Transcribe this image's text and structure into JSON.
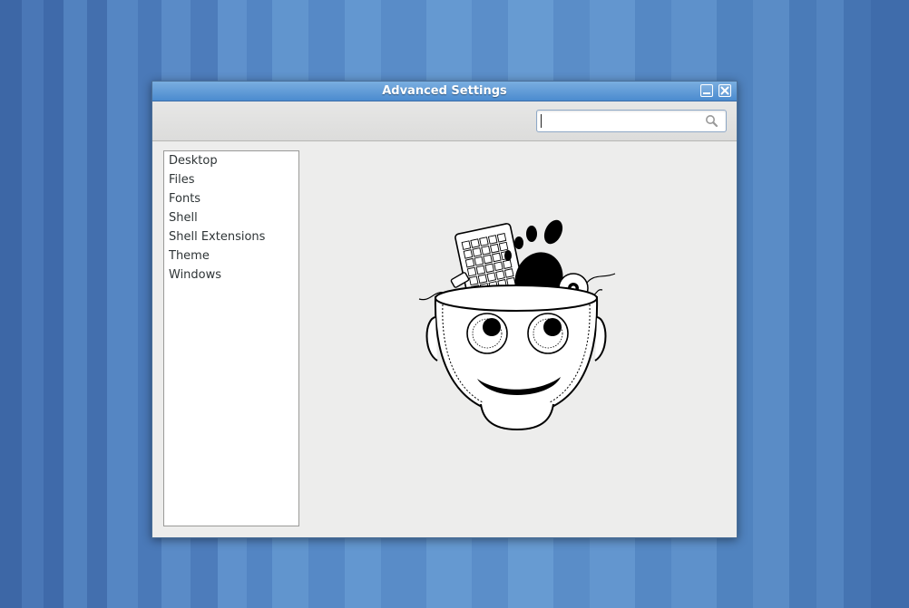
{
  "window": {
    "title": "Advanced Settings",
    "buttons": {
      "minimize_icon": "minimize-icon",
      "close_icon": "close-icon"
    }
  },
  "toolbar": {
    "search": {
      "value": "",
      "placeholder": "",
      "icon": "search-icon"
    }
  },
  "sidebar": {
    "items": [
      {
        "label": "Desktop"
      },
      {
        "label": "Files"
      },
      {
        "label": "Fonts"
      },
      {
        "label": "Shell"
      },
      {
        "label": "Shell Extensions"
      },
      {
        "label": "Theme"
      },
      {
        "label": "Windows"
      }
    ]
  },
  "main": {
    "illustration": "gnome-tweak-tool-logo"
  },
  "colors": {
    "titlebar": "#4b8bcf",
    "window_bg": "#ededec",
    "desktop": "#5a8cc6"
  }
}
